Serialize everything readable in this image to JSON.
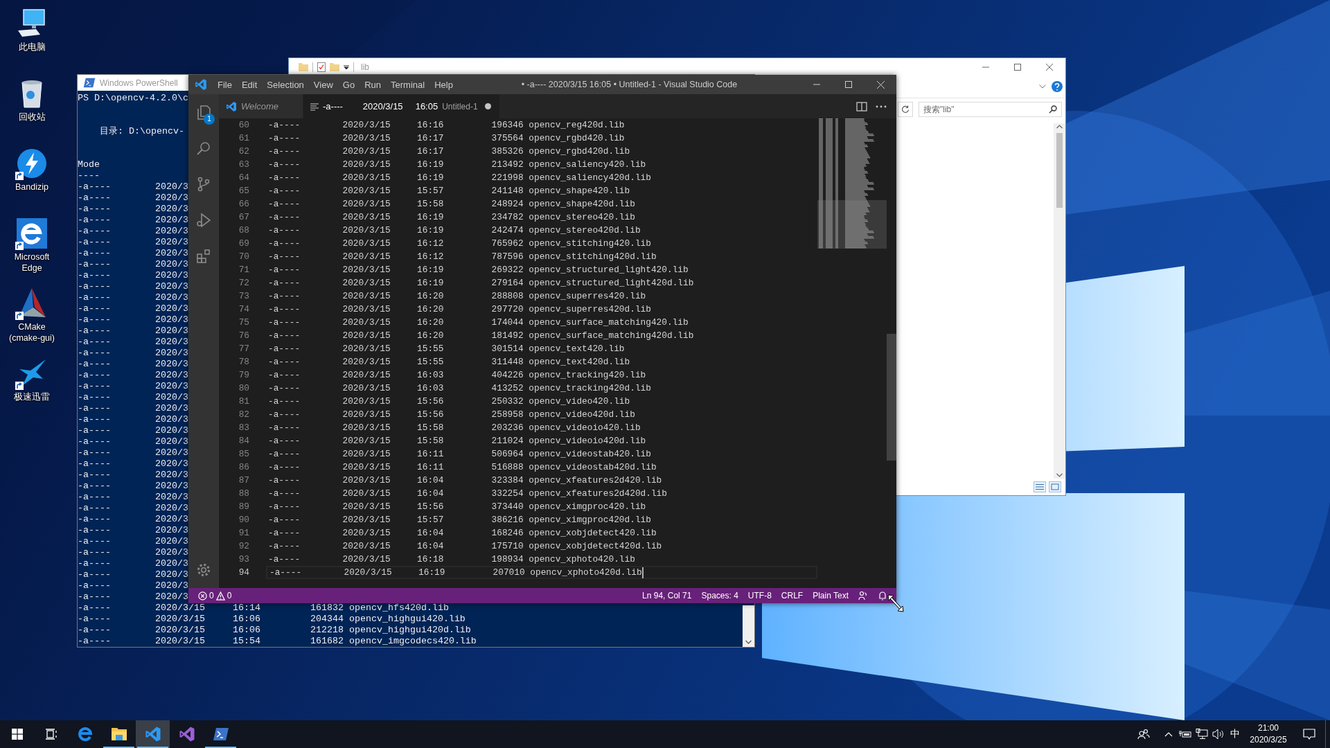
{
  "desktop": {
    "icons": [
      {
        "label": "此电脑",
        "kind": "computer",
        "shortcut": false
      },
      {
        "label": "回收站",
        "kind": "recycle-bin",
        "shortcut": false
      },
      {
        "label": "Bandizip",
        "kind": "bandizip",
        "shortcut": true
      },
      {
        "label": "Microsoft Edge",
        "kind": "edge",
        "shortcut": true
      },
      {
        "label": "CMake (cmake-gui)",
        "kind": "cmake",
        "shortcut": true
      },
      {
        "label": "极速迅雷",
        "kind": "bird",
        "shortcut": true
      }
    ]
  },
  "explorer": {
    "title": "lib",
    "search": {
      "placeholder": "搜索\"lib\""
    }
  },
  "powershell": {
    "title": "Windows PowerShell",
    "prompt": "PS D:\\opencv-4.2.0\\c",
    "directory": "目录: D:\\opencv-",
    "column_header": "Mode",
    "column_rule": "----",
    "rows": [
      "-a----        2020/3",
      "-a----        2020/3",
      "-a----        2020/3",
      "-a----        2020/3",
      "-a----        2020/3",
      "-a----        2020/3",
      "-a----        2020/3",
      "-a----        2020/3",
      "-a----        2020/3",
      "-a----        2020/3",
      "-a----        2020/3",
      "-a----        2020/3",
      "-a----        2020/3",
      "-a----        2020/3",
      "-a----        2020/3",
      "-a----        2020/3",
      "-a----        2020/3",
      "-a----        2020/3",
      "-a----        2020/3",
      "-a----        2020/3",
      "-a----        2020/3",
      "-a----        2020/3",
      "-a----        2020/3",
      "-a----        2020/3",
      "-a----        2020/3",
      "-a----        2020/3",
      "-a----        2020/3",
      "-a----        2020/3",
      "-a----        2020/3",
      "-a----        2020/3",
      "-a----        2020/3",
      "-a----        2020/3",
      "-a----        2020/3",
      "-a----        2020/3",
      "-a----        2020/3",
      "-a----        2020/3",
      "-a----        2020/3",
      "-a----        2020/3",
      "-a----        2020/3/15     16:14         161832 opencv_hfs420d.lib",
      "-a----        2020/3/15     16:06         204344 opencv_highgui420.lib",
      "-a----        2020/3/15     16:06         212218 opencv_highgui420d.lib",
      "-a----        2020/3/15     15:54         161682 opencv_imgcodecs420.lib"
    ]
  },
  "vscode": {
    "title": "• -a---- 2020/3/15 16:05 • Untitled-1 - Visual Studio Code",
    "menu": [
      "File",
      "Edit",
      "Selection",
      "View",
      "Go",
      "Run",
      "Terminal",
      "Help"
    ],
    "activity_bar": [
      {
        "kind": "files",
        "badge": "1"
      },
      {
        "kind": "search"
      },
      {
        "kind": "source-control"
      },
      {
        "kind": "run"
      },
      {
        "kind": "extensions"
      },
      {
        "kind": "settings"
      }
    ],
    "tabs": [
      {
        "kind": "welcome",
        "label": "Welcome",
        "selected": false
      },
      {
        "kind": "file",
        "label": "-a----        2020/3/15     16:05",
        "description": "Untitled-1",
        "dirty": true,
        "selected": true
      }
    ],
    "editor": {
      "lines": [
        {
          "number": "60",
          "text": "-a----        2020/3/15     16:16         196346 opencv_reg420d.lib",
          "current": false
        },
        {
          "number": "61",
          "text": "-a----        2020/3/15     16:17         375564 opencv_rgbd420.lib",
          "current": false
        },
        {
          "number": "62",
          "text": "-a----        2020/3/15     16:17         385326 opencv_rgbd420d.lib",
          "current": false
        },
        {
          "number": "63",
          "text": "-a----        2020/3/15     16:19         213492 opencv_saliency420.lib",
          "current": false
        },
        {
          "number": "64",
          "text": "-a----        2020/3/15     16:19         221998 opencv_saliency420d.lib",
          "current": false
        },
        {
          "number": "65",
          "text": "-a----        2020/3/15     15:57         241148 opencv_shape420.lib",
          "current": false
        },
        {
          "number": "66",
          "text": "-a----        2020/3/15     15:58         248924 opencv_shape420d.lib",
          "current": false
        },
        {
          "number": "67",
          "text": "-a----        2020/3/15     16:19         234782 opencv_stereo420.lib",
          "current": false
        },
        {
          "number": "68",
          "text": "-a----        2020/3/15     16:19         242474 opencv_stereo420d.lib",
          "current": false
        },
        {
          "number": "69",
          "text": "-a----        2020/3/15     16:12         765962 opencv_stitching420.lib",
          "current": false
        },
        {
          "number": "70",
          "text": "-a----        2020/3/15     16:12         787596 opencv_stitching420d.lib",
          "current": false
        },
        {
          "number": "71",
          "text": "-a----        2020/3/15     16:19         269322 opencv_structured_light420.lib",
          "current": false
        },
        {
          "number": "72",
          "text": "-a----        2020/3/15     16:19         279164 opencv_structured_light420d.lib",
          "current": false
        },
        {
          "number": "73",
          "text": "-a----        2020/3/15     16:20         288808 opencv_superres420.lib",
          "current": false
        },
        {
          "number": "74",
          "text": "-a----        2020/3/15     16:20         297720 opencv_superres420d.lib",
          "current": false
        },
        {
          "number": "75",
          "text": "-a----        2020/3/15     16:20         174044 opencv_surface_matching420.lib",
          "current": false
        },
        {
          "number": "76",
          "text": "-a----        2020/3/15     16:20         181492 opencv_surface_matching420d.lib",
          "current": false
        },
        {
          "number": "77",
          "text": "-a----        2020/3/15     15:55         301514 opencv_text420.lib",
          "current": false
        },
        {
          "number": "78",
          "text": "-a----        2020/3/15     15:55         311448 opencv_text420d.lib",
          "current": false
        },
        {
          "number": "79",
          "text": "-a----        2020/3/15     16:03         404226 opencv_tracking420.lib",
          "current": false
        },
        {
          "number": "80",
          "text": "-a----        2020/3/15     16:03         413252 opencv_tracking420d.lib",
          "current": false
        },
        {
          "number": "81",
          "text": "-a----        2020/3/15     15:56         250332 opencv_video420.lib",
          "current": false
        },
        {
          "number": "82",
          "text": "-a----        2020/3/15     15:56         258958 opencv_video420d.lib",
          "current": false
        },
        {
          "number": "83",
          "text": "-a----        2020/3/15     15:58         203236 opencv_videoio420.lib",
          "current": false
        },
        {
          "number": "84",
          "text": "-a----        2020/3/15     15:58         211024 opencv_videoio420d.lib",
          "current": false
        },
        {
          "number": "85",
          "text": "-a----        2020/3/15     16:11         506964 opencv_videostab420.lib",
          "current": false
        },
        {
          "number": "86",
          "text": "-a----        2020/3/15     16:11         516888 opencv_videostab420d.lib",
          "current": false
        },
        {
          "number": "87",
          "text": "-a----        2020/3/15     16:04         323384 opencv_xfeatures2d420.lib",
          "current": false
        },
        {
          "number": "88",
          "text": "-a----        2020/3/15     16:04         332254 opencv_xfeatures2d420d.lib",
          "current": false
        },
        {
          "number": "89",
          "text": "-a----        2020/3/15     15:56         373440 opencv_ximgproc420.lib",
          "current": false
        },
        {
          "number": "90",
          "text": "-a----        2020/3/15     15:57         386216 opencv_ximgproc420d.lib",
          "current": false
        },
        {
          "number": "91",
          "text": "-a----        2020/3/15     16:04         168246 opencv_xobjdetect420.lib",
          "current": false
        },
        {
          "number": "92",
          "text": "-a----        2020/3/15     16:04         175710 opencv_xobjdetect420d.lib",
          "current": false
        },
        {
          "number": "93",
          "text": "-a----        2020/3/15     16:18         198934 opencv_xphoto420.lib",
          "current": false
        },
        {
          "number": "94",
          "text": "-a----        2020/3/15     16:19         207010 opencv_xphoto420d.lib",
          "current": true
        }
      ]
    },
    "status_bar": {
      "errors": "0",
      "warnings": "0",
      "items": [
        "Ln 94, Col 71",
        "Spaces: 4",
        "UTF-8",
        "CRLF",
        "Plain Text"
      ]
    }
  },
  "taskbar": {
    "apps": [
      {
        "kind": "start",
        "running": false,
        "selected": false
      },
      {
        "kind": "task-view",
        "running": false,
        "selected": false
      },
      {
        "kind": "edge",
        "running": false,
        "selected": false
      },
      {
        "kind": "explorer",
        "running": true,
        "selected": false
      },
      {
        "kind": "vscode",
        "running": true,
        "selected": true
      },
      {
        "kind": "visual-studio",
        "running": false,
        "selected": false
      },
      {
        "kind": "powershell",
        "running": true,
        "selected": false
      }
    ],
    "tray": {
      "ime": "中",
      "time": "21:00",
      "date": "2020/3/25"
    }
  }
}
